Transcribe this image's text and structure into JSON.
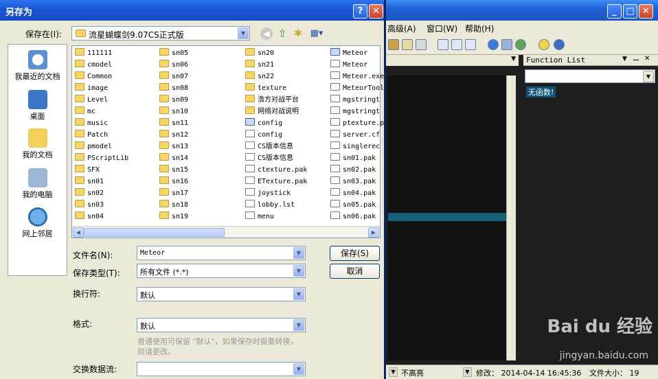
{
  "dialog": {
    "title": "另存为",
    "help_label": "?",
    "close_label": "✕",
    "save_in_label": "保存在(I):",
    "save_in_value": "流星蝴蝶剑9.07CS正式版",
    "filename_label": "文件名(N):",
    "filename_value": "Meteor",
    "filetype_label": "保存类型(T):",
    "filetype_value": "所有文件 (*.*)",
    "linebreak_label": "换行符:",
    "linebreak_value": "默认",
    "format_label": "格式:",
    "format_value": "默认",
    "hint": "普通使用可保留 \"默认\"，如果保存时需要转换，则请更改。",
    "stream_label": "交换数据流:",
    "stream_value": "",
    "save_button": "保存(S)",
    "cancel_button": "取消"
  },
  "places": [
    {
      "label": "我最近的文档",
      "icon": "recent-documents-icon"
    },
    {
      "label": "桌面",
      "icon": "desktop-icon"
    },
    {
      "label": "我的文档",
      "icon": "my-documents-icon"
    },
    {
      "label": "我的电脑",
      "icon": "my-computer-icon"
    },
    {
      "label": "网上邻居",
      "icon": "network-places-icon"
    }
  ],
  "files": {
    "col1": [
      "111111",
      "cmodel",
      "Common",
      "image",
      "Level",
      "mc",
      "music",
      "Patch",
      "pmodel",
      "PScriptLib",
      "SFX",
      "sn01",
      "sn02",
      "sn03",
      "sn04"
    ],
    "col2": [
      "sn05",
      "sn06",
      "sn07",
      "sn08",
      "sn09",
      "sn10",
      "sn11",
      "sn12",
      "sn13",
      "sn14",
      "sn15",
      "sn16",
      "sn17",
      "sn18",
      "sn19"
    ],
    "col3": [
      "sn20",
      "sn21",
      "sn22",
      "texture",
      "浩方对战平台",
      "网络对战说明",
      "config",
      "config",
      "CS版本信息",
      "CS版本信息",
      "ctexture.pak",
      "ETexture.pak",
      "joystick",
      "lobby.lst",
      "menu"
    ],
    "col4": [
      "Meteor",
      "Meteor",
      "Meteor.exe",
      "MeteorTool",
      "mgstringt",
      "mgstringt",
      "ptexture.p",
      "server.cf",
      "singlerec",
      "sn01.pak",
      "sn02.pak",
      "sn03.pak",
      "sn04.pak",
      "sn05.pak",
      "sn06.pak"
    ]
  },
  "file_types": {
    "col3": [
      "folder",
      "folder",
      "folder",
      "folder",
      "folder",
      "folder",
      "app",
      "doc",
      "doc",
      "doc",
      "doc",
      "doc",
      "doc",
      "doc",
      "doc"
    ],
    "col4": [
      "app",
      "doc",
      "doc",
      "doc",
      "doc",
      "doc",
      "doc",
      "doc",
      "doc",
      "doc",
      "doc",
      "doc",
      "doc",
      "doc",
      "doc"
    ]
  },
  "app": {
    "menu": [
      "高级(A)",
      "窗口(W)",
      "帮助(H)"
    ],
    "function_list_title": "Function List",
    "no_functions": "无函数!",
    "status_highlight": "不高亮",
    "status_modified": "修改：  2014-04-14 16:45:36",
    "status_filesize": "文件大小：  19"
  },
  "watermark": {
    "brand": "Bai du 经验",
    "url": "jingyan.baidu.com"
  }
}
